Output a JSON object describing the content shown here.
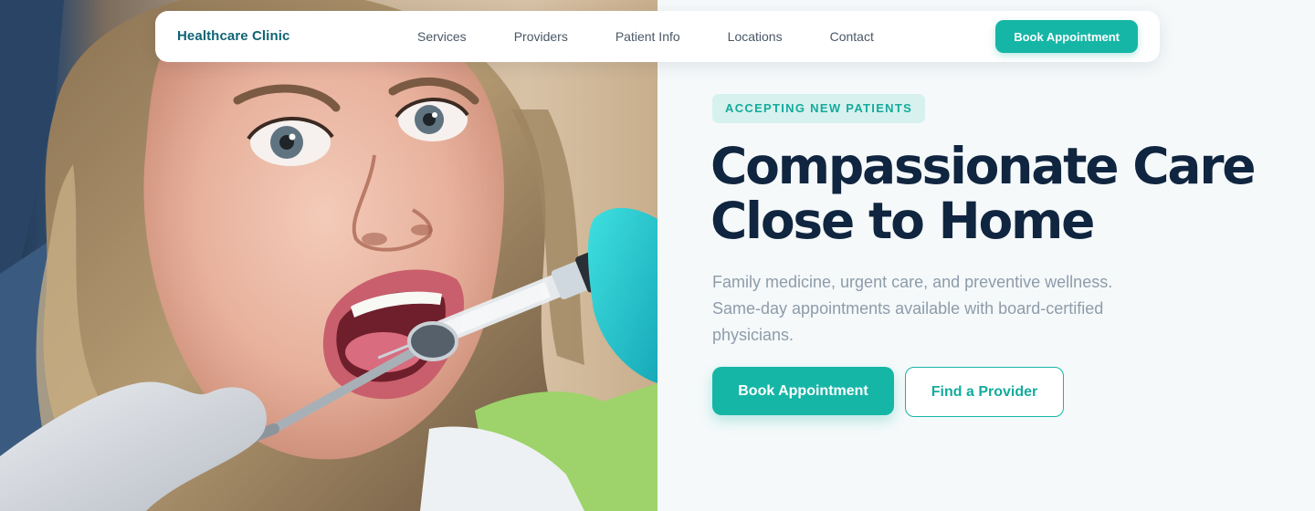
{
  "nav": {
    "brand": "Healthcare Clinic",
    "links": [
      "Services",
      "Providers",
      "Patient Info",
      "Locations",
      "Contact"
    ],
    "cta_label": "Book Appointment"
  },
  "hero": {
    "badge": "ACCEPTING NEW PATIENTS",
    "title_line1": "Compassionate Care",
    "title_line2": "Close to Home",
    "subtitle": "Family medicine, urgent care, and preventive wellness. Same-day appointments available with board-certified physicians.",
    "primary_cta": "Book Appointment",
    "secondary_cta": "Find a Provider"
  },
  "colors": {
    "accent": "#16b6a6",
    "brand": "#0f6475",
    "heading": "#10253f",
    "body_text": "#8e9caa",
    "badge_bg": "#d7f1ee",
    "page_bg": "#f5f9fa"
  }
}
